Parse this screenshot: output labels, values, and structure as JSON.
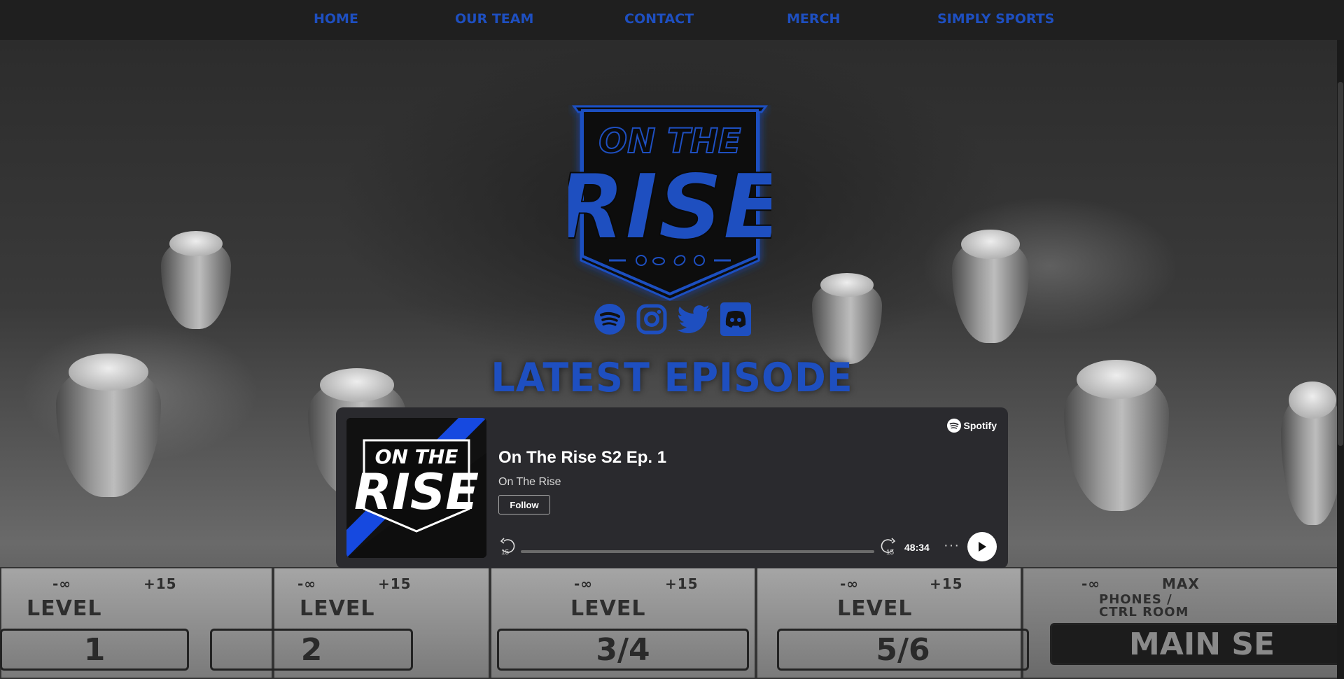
{
  "nav": {
    "items": [
      {
        "label": "HOME"
      },
      {
        "label": "OUR TEAM"
      },
      {
        "label": "CONTACT"
      },
      {
        "label": "MERCH"
      },
      {
        "label": "SIMPLY SPORTS"
      }
    ]
  },
  "logo": {
    "line1": "ON THE",
    "line2": "RISE"
  },
  "social": [
    "spotify-icon",
    "instagram-icon",
    "twitter-icon",
    "discord-icon"
  ],
  "section": {
    "heading": "LATEST EPISODE"
  },
  "background": {
    "channels": [
      "1",
      "2",
      "3/4",
      "5/6",
      "MAIN SE"
    ],
    "level_label": "LEVEL",
    "scale_min": "-∞",
    "scale_max": "+15",
    "phones_label": "PHONES /\nCTRL ROOM",
    "max_label": "MAX"
  },
  "player": {
    "brand": "Spotify",
    "episode_title": "On The Rise S2 Ep. 1",
    "show_name": "On The Rise",
    "follow_label": "Follow",
    "skip_back": "15",
    "skip_forward": "15",
    "duration": "48:34",
    "more": "···",
    "cover_line1": "ON THE",
    "cover_line2": "RISE"
  },
  "colors": {
    "accent": "#1e4fc0",
    "nav_bg": "#1f1f1f",
    "player_bg": "#2a2a2e"
  }
}
